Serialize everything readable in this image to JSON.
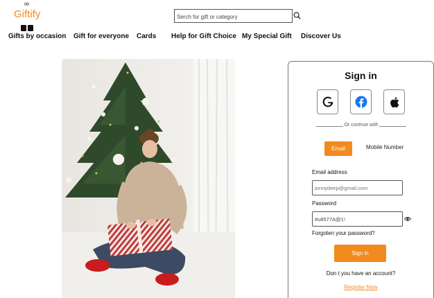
{
  "header": {
    "logo_text": "Giftify",
    "logo_mark": "∞",
    "search": {
      "placeholder": "Serch for gift or category"
    }
  },
  "nav": {
    "items": [
      {
        "label": "Gifts by occasion"
      },
      {
        "label": "Gift for everyone"
      },
      {
        "label": "Cards"
      },
      {
        "label": "Help for Gift Choice"
      },
      {
        "label": "My Special Gift"
      },
      {
        "label": "Discover Us"
      }
    ]
  },
  "signin": {
    "title": "Sign in",
    "social_buttons": [
      "google-icon",
      "facebook-icon",
      "apple-icon"
    ],
    "divider_text": "Or contnue with",
    "tabs": {
      "email": "Email",
      "mobile": "Mobile Number",
      "active": "Email"
    },
    "email_label": "Email address",
    "email_placeholder": "jonnydeep@gmail.com",
    "password_label": "Password",
    "password_value": "#u8577A@1!",
    "forgot_text": "Forgoten your password?",
    "signin_button": "Sign in",
    "no_account_text": "Don t you have an account?",
    "register_link": "Register Now"
  },
  "colors": {
    "accent": "#f28a1e",
    "facebook": "#1877f2"
  }
}
